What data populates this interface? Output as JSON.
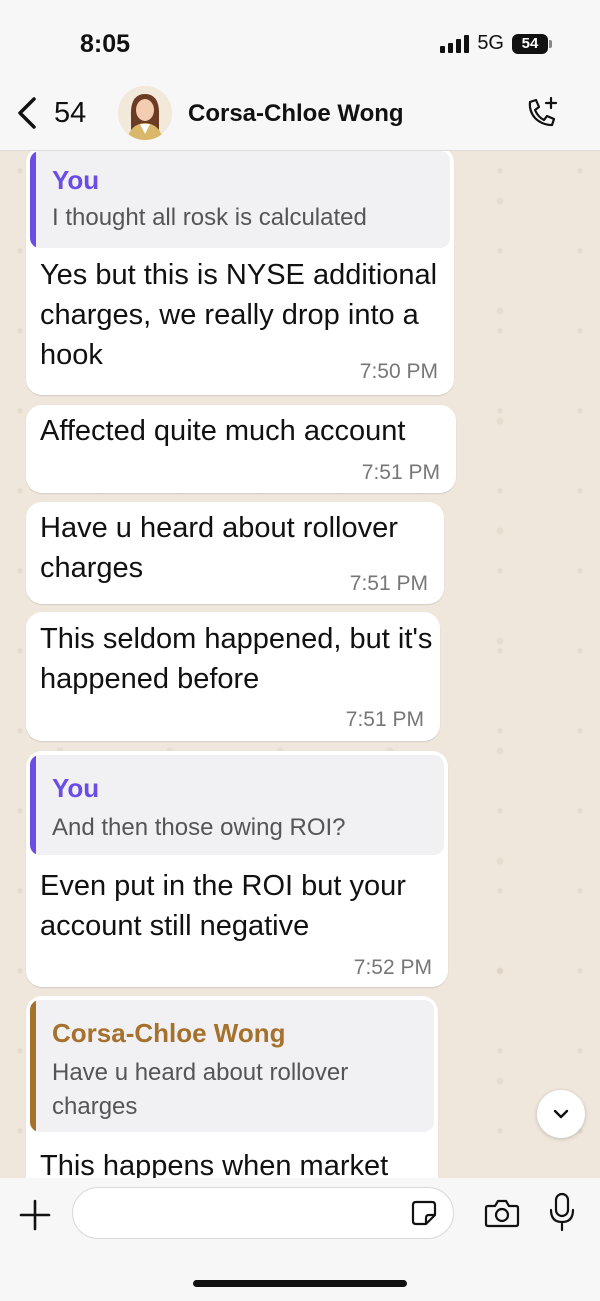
{
  "status": {
    "time": "8:05",
    "network": "5G",
    "battery": "54"
  },
  "header": {
    "back_count": "54",
    "contact_name": "Corsa-Chloe Wong"
  },
  "colors": {
    "you_quote": "#6b4de6",
    "contact_quote": "#a5712c",
    "bubble": "#ffffff"
  },
  "messages": [
    {
      "quote_author": "You",
      "quote_text": "I thought all rosk is calculated",
      "text": "Yes but this is NYSE additional charges, we really drop into a hook",
      "time": "7:50 PM"
    },
    {
      "text": "Affected quite much account",
      "time": "7:51 PM"
    },
    {
      "text": "Have u heard about rollover charges",
      "time": "7:51 PM"
    },
    {
      "text": "This seldom happened, but it's happened before",
      "time": "7:51 PM"
    },
    {
      "quote_author": "You",
      "quote_text": "And then those owing ROI?",
      "text": "Even put in the ROI but your account still negative",
      "time": "7:52 PM"
    },
    {
      "quote_author": "Corsa-Chloe Wong",
      "quote_text": "Have u heard about rollover charges",
      "text": "This happens when market"
    }
  ],
  "composer": {
    "value": "",
    "placeholder": ""
  }
}
